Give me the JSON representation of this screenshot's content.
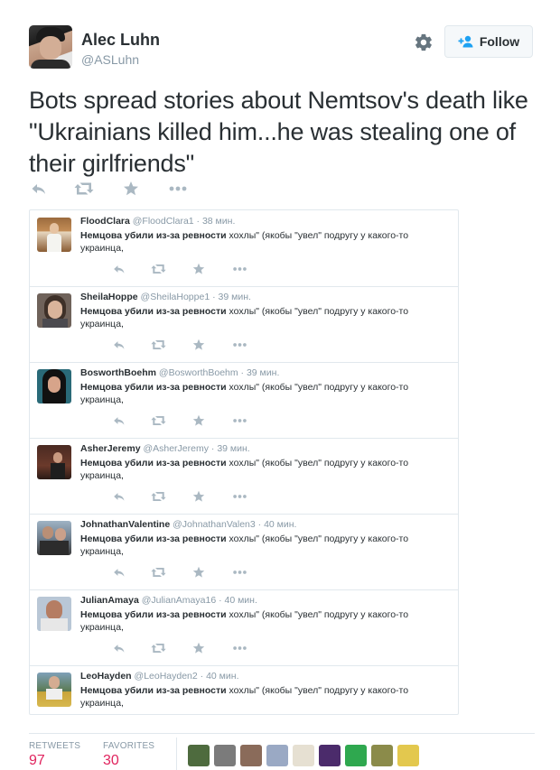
{
  "author": {
    "name": "Alec Luhn",
    "handle": "@ASLuhn"
  },
  "follow_label": "Follow",
  "tweet_text": "Bots spread stories about Nemtsov's death like \"Ukrainians killed him...he was stealing one of their girlfriends\"",
  "embedded": {
    "tweets": [
      {
        "name": "FloodClara",
        "handle": "@FloodClara1",
        "time": "· 38 мин.",
        "bold": "Немцова убили из-за ревности",
        "rest": " хохлы\" (якобы \"увел\" подругу у какого-то украинца,"
      },
      {
        "name": "SheilaHoppe",
        "handle": "@SheilaHoppe1",
        "time": "· 39 мин.",
        "bold": "Немцова убили из-за ревности",
        "rest": " хохлы\" (якобы \"увел\" подругу у какого-то украинца,"
      },
      {
        "name": "BosworthBoehm",
        "handle": "@BosworthBoehm",
        "time": "· 39 мин.",
        "bold": "Немцова убили из-за ревности",
        "rest": " хохлы\" (якобы \"увел\" подругу у какого-то украинца,"
      },
      {
        "name": "AsherJeremy",
        "handle": "@AsherJeremy",
        "time": "· 39 мин.",
        "bold": "Немцова убили из-за ревности",
        "rest": " хохлы\" (якобы \"увел\" подругу у какого-то украинца,"
      },
      {
        "name": "JohnathanValentine",
        "handle": "@JohnathanValen3",
        "time": "· 40 мин.",
        "bold": "Немцова убили из-за ревности",
        "rest": " хохлы\" (якобы \"увел\" подругу у какого-то украинца,"
      },
      {
        "name": "JulianAmaya",
        "handle": "@JulianAmaya16",
        "time": "· 40 мин.",
        "bold": "Немцова убили из-за ревности",
        "rest": " хохлы\" (якобы \"увел\" подругу у какого-то украинца,"
      },
      {
        "name": "LeoHayden",
        "handle": "@LeoHayden2",
        "time": "· 40 мин.",
        "bold": "Немцова убили из-за ревности",
        "rest": " хохлы\" (якобы \"увел\" подругу у какого-то украинца,"
      }
    ]
  },
  "stats": {
    "retweets_label": "RETWEETS",
    "retweets": "97",
    "favorites_label": "FAVORITES",
    "favorites": "30"
  },
  "colors": {
    "stat_value": "#e0245e",
    "icon": "#aab8c2",
    "name": "#292f33",
    "muted": "#8899a6"
  },
  "icons": [
    "reply-icon",
    "retweet-icon",
    "favorite-icon",
    "more-icon",
    "gear-icon",
    "add-user-icon"
  ]
}
